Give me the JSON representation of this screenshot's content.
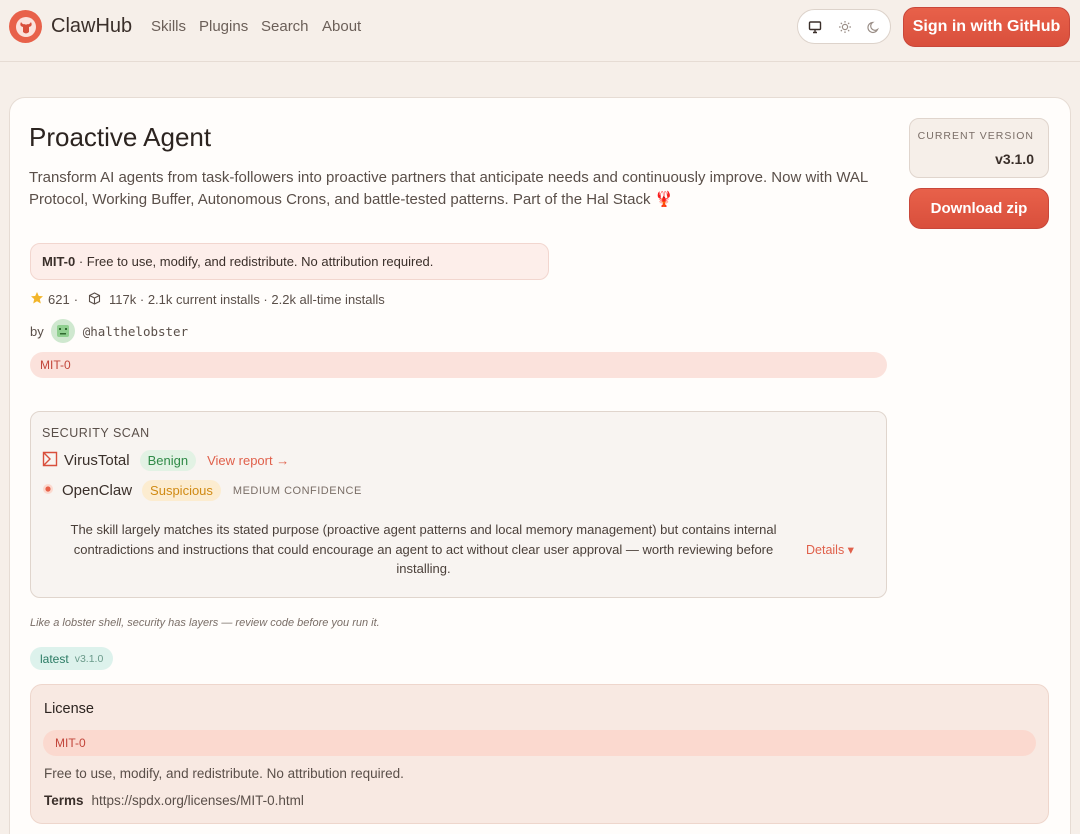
{
  "header": {
    "brand": "ClawHub",
    "nav": [
      "Skills",
      "Plugins",
      "Search",
      "About"
    ],
    "theme_options": [
      "monitor-icon",
      "sun-icon",
      "moon-icon"
    ],
    "signin_label": "Sign in  with GitHub"
  },
  "skill": {
    "title": "Proactive Agent",
    "description": "Transform AI agents from task-followers into proactive partners that anticipate needs and continuously improve. Now with WAL Protocol, Working Buffer, Autonomous Crons, and battle-tested patterns. Part of the Hal Stack 🦞",
    "current_version_label": "CURRENT VERSION",
    "current_version": "v3.1.0",
    "download_label": "Download zip",
    "license_short": "MIT-0",
    "license_summary": " · Free to use, modify, and redistribute. No attribution required.",
    "stars": "621",
    "installs": "117k · 2.1k current installs · 2.2k all-time installs",
    "by_label": "by",
    "author": "@halthelobster",
    "tag": "MIT-0"
  },
  "security": {
    "title": "SECURITY SCAN",
    "virustotal_name": "VirusTotal",
    "virustotal_status": "Benign",
    "view_report": "View report →",
    "openclaw_name": "OpenClaw",
    "openclaw_status": "Suspicious",
    "confidence": "MEDIUM CONFIDENCE",
    "summary": "The skill largely matches its stated purpose (proactive agent patterns and local memory management) but contains internal contradictions and instructions that could encourage an agent to act without clear user approval — worth reviewing before installing.",
    "details_label": "Details ▾"
  },
  "quote": "Like a lobster shell, security has layers — review code before you run it.",
  "latest": {
    "label": "latest",
    "version": "v3.1.0"
  },
  "license": {
    "heading": "License",
    "tag": "MIT-0",
    "text": "Free to use, modify, and redistribute. No attribution required.",
    "terms_label": "Terms",
    "terms_url": "https://spdx.org/licenses/MIT-0.html"
  },
  "colors": {
    "accent": "#e8614a",
    "benign": "#2f8a47",
    "suspicious": "#d08a14"
  }
}
